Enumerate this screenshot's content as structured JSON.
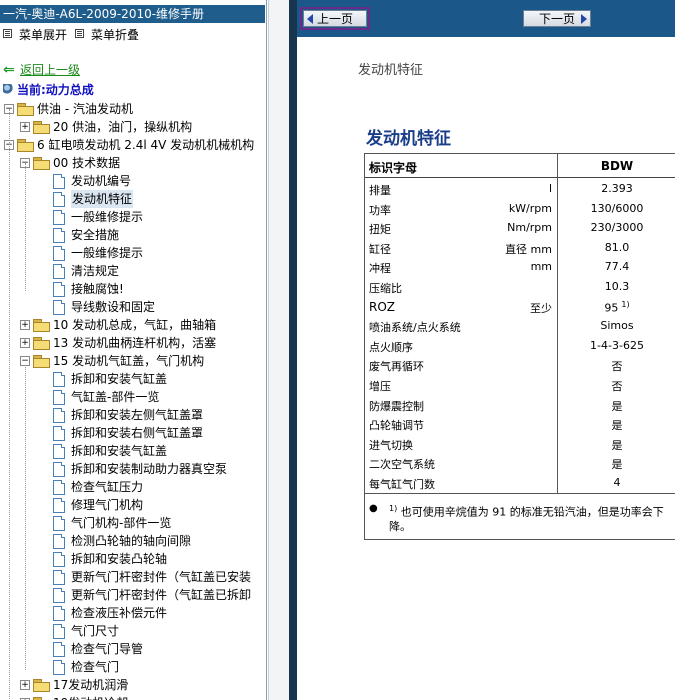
{
  "window_title": "一汽-奥迪-A6L-2009-2010-维修手册",
  "menu": {
    "expand": "菜单展开",
    "collapse": "菜单折叠"
  },
  "back_link": "返回上一级",
  "current": "当前:动力总成",
  "tree": [
    {
      "label": "供油 - 汽油发动机",
      "level": 0,
      "kind": "folder",
      "toggle": "−"
    },
    {
      "label": "20 供油，油门，操纵机构",
      "level": 1,
      "kind": "folder",
      "toggle": "+"
    },
    {
      "label": "6 缸电喷发动机  2.4l 4V 发动机机械机构",
      "level": 0,
      "kind": "folder",
      "toggle": "−"
    },
    {
      "label": "00 技术数据",
      "level": 1,
      "kind": "folder",
      "toggle": "−"
    },
    {
      "label": "发动机编号",
      "level": 2,
      "kind": "doc"
    },
    {
      "label": "发动机特征",
      "level": 2,
      "kind": "doc",
      "selected": true
    },
    {
      "label": "一般维修提示",
      "level": 2,
      "kind": "doc"
    },
    {
      "label": "安全措施",
      "level": 2,
      "kind": "doc"
    },
    {
      "label": "一般维修提示",
      "level": 2,
      "kind": "doc"
    },
    {
      "label": "清洁规定",
      "level": 2,
      "kind": "doc"
    },
    {
      "label": "接触腐蚀!",
      "level": 2,
      "kind": "doc"
    },
    {
      "label": "导线敷设和固定",
      "level": 2,
      "kind": "doc"
    },
    {
      "label": "10 发动机总成，气缸，曲轴箱",
      "level": 1,
      "kind": "folder",
      "toggle": "+"
    },
    {
      "label": "13 发动机曲柄连杆机构，活塞",
      "level": 1,
      "kind": "folder",
      "toggle": "+"
    },
    {
      "label": "15 发动机气缸盖，气门机构",
      "level": 1,
      "kind": "folder",
      "toggle": "−"
    },
    {
      "label": "拆卸和安装气缸盖",
      "level": 2,
      "kind": "doc"
    },
    {
      "label": "气缸盖-部件一览",
      "level": 2,
      "kind": "doc"
    },
    {
      "label": "拆卸和安装左侧气缸盖罩",
      "level": 2,
      "kind": "doc"
    },
    {
      "label": "拆卸和安装右侧气缸盖罩",
      "level": 2,
      "kind": "doc"
    },
    {
      "label": "拆卸和安装气缸盖",
      "level": 2,
      "kind": "doc"
    },
    {
      "label": "拆卸和安装制动助力器真空泵",
      "level": 2,
      "kind": "doc"
    },
    {
      "label": "检查气缸压力",
      "level": 2,
      "kind": "doc"
    },
    {
      "label": "修理气门机构",
      "level": 2,
      "kind": "doc"
    },
    {
      "label": "气门机构-部件一览",
      "level": 2,
      "kind": "doc"
    },
    {
      "label": "检测凸轮轴的轴向间隙",
      "level": 2,
      "kind": "doc"
    },
    {
      "label": "拆卸和安装凸轮轴",
      "level": 2,
      "kind": "doc"
    },
    {
      "label": "更新气门杆密封件（气缸盖已安装",
      "level": 2,
      "kind": "doc"
    },
    {
      "label": "更新气门杆密封件（气缸盖已拆卸",
      "level": 2,
      "kind": "doc"
    },
    {
      "label": "检查液压补偿元件",
      "level": 2,
      "kind": "doc"
    },
    {
      "label": "气门尺寸",
      "level": 2,
      "kind": "doc"
    },
    {
      "label": "检查气门导管",
      "level": 2,
      "kind": "doc"
    },
    {
      "label": "检查气门",
      "level": 2,
      "kind": "doc"
    },
    {
      "label": "17发动机润滑",
      "level": 1,
      "kind": "folder",
      "toggle": "+"
    },
    {
      "label": "19发动机冷却",
      "level": 1,
      "kind": "folder",
      "toggle": "+"
    }
  ],
  "nav": {
    "prev": "上一页",
    "next": "下一页"
  },
  "page_header": "发动机特征",
  "section_title": "发动机特征",
  "table": {
    "header": {
      "label": "标识字母",
      "value": "BDW"
    },
    "rows": [
      {
        "label": "排量",
        "unit": "l",
        "value": "2.393"
      },
      {
        "label": "功率",
        "unit": "kW/rpm",
        "value": "130/6000"
      },
      {
        "label": "扭矩",
        "unit": "Nm/rpm",
        "value": "230/3000"
      },
      {
        "label": "缸径",
        "unit": "直径 mm",
        "value": "81.0"
      },
      {
        "label": "冲程",
        "unit": "mm",
        "value": "77.4"
      },
      {
        "label": "压缩比",
        "unit": "",
        "value": "10.3"
      },
      {
        "label": "ROZ",
        "unit": "至少",
        "value": "95",
        "sup": "1)"
      },
      {
        "label": "喷油系统/点火系统",
        "unit": "",
        "value": "Simos"
      },
      {
        "label": "点火顺序",
        "unit": "",
        "value": "1-4-3-625"
      },
      {
        "label": "废气再循环",
        "unit": "",
        "value": "否"
      },
      {
        "label": "增压",
        "unit": "",
        "value": "否"
      },
      {
        "label": "防爆震控制",
        "unit": "",
        "value": "是"
      },
      {
        "label": "凸轮轴调节",
        "unit": "",
        "value": "是"
      },
      {
        "label": "进气切换",
        "unit": "",
        "value": "是"
      },
      {
        "label": "二次空气系统",
        "unit": "",
        "value": "是"
      },
      {
        "label": "每气缸气门数",
        "unit": "",
        "value": "4"
      }
    ],
    "footnote_mark": "1)",
    "footnote": "也可使用辛烷值为 91 的标准无铅汽油，但是功率会下降。"
  }
}
